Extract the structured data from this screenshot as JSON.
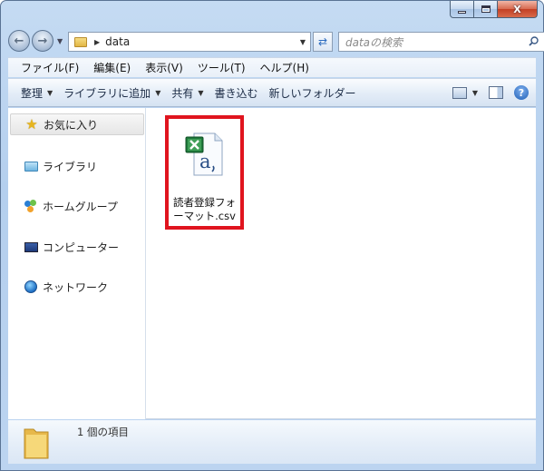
{
  "window": {
    "caption_buttons": {
      "minimize": "minimize",
      "maximize": "maximize",
      "close": "X"
    }
  },
  "navigation": {
    "address_path": "data",
    "search_placeholder": "dataの検索"
  },
  "menu": [
    "ファイル(F)",
    "編集(E)",
    "表示(V)",
    "ツール(T)",
    "ヘルプ(H)"
  ],
  "toolbar": {
    "organize": "整理",
    "add_to_library": "ライブラリに追加",
    "share": "共有",
    "burn": "書き込む",
    "new_folder": "新しいフォルダー"
  },
  "sidebar": {
    "items": [
      {
        "label": "お気に入り",
        "icon": "star-icon"
      },
      {
        "label": "ライブラリ",
        "icon": "library-icon"
      },
      {
        "label": "ホームグループ",
        "icon": "homegroup-icon"
      },
      {
        "label": "コンピューター",
        "icon": "computer-icon"
      },
      {
        "label": "ネットワーク",
        "icon": "network-icon"
      }
    ]
  },
  "files": [
    {
      "name": "読者登録フォーマット.csv",
      "icon": "excel-csv-icon",
      "highlighted": true,
      "highlight_color": "#e0141e"
    }
  ],
  "details": {
    "count": "1 個の項目"
  }
}
